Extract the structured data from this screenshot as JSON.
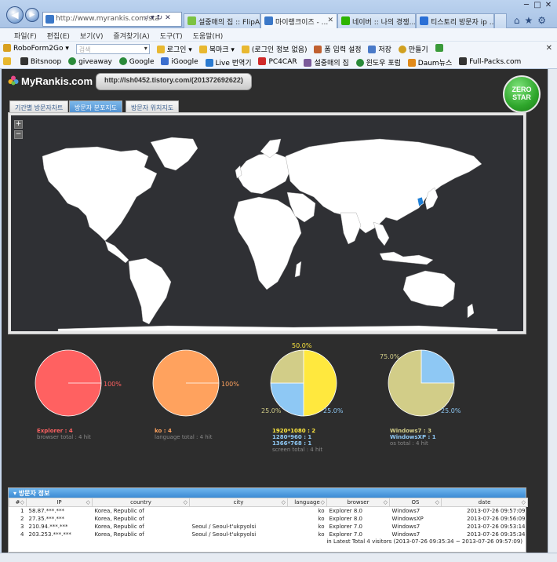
{
  "browser": {
    "address": "http://www.myrankis.com/sta",
    "address_host": "myrankis.com",
    "tabs": [
      {
        "label": "설중매의 집 :: FlipAl...",
        "color": "#7cc242"
      },
      {
        "label": "마이랭크이즈 - ...",
        "color": "#3b78c8"
      },
      {
        "label": "네이버 :: 나의 경쟁...",
        "color": "#2db400"
      },
      {
        "label": "티스토리 방문자 ip ...",
        "color": "#2a6fd6"
      }
    ],
    "menu": [
      "파일(F)",
      "편집(E)",
      "보기(V)",
      "즐겨찾기(A)",
      "도구(T)",
      "도움말(H)"
    ],
    "toolbar": {
      "roboform": "RoboForm2Go",
      "search_placeholder": "검색",
      "login": "로그인",
      "bookmark": "북마크",
      "login_info": "(로그인 정보 없음)",
      "form_settings": "폼 입력 설정",
      "save": "저장",
      "make": "만들기"
    },
    "favorites": [
      {
        "label": "Bitsnoop",
        "color": "#333333"
      },
      {
        "label": "giveaway",
        "color": "#2a8a3a"
      },
      {
        "label": "Google",
        "color": "#2a8a3a"
      },
      {
        "label": "iGoogle",
        "color": "#3b6fd0"
      },
      {
        "label": "Live 번역기",
        "color": "#2a7ad0"
      },
      {
        "label": "PC4CAR",
        "color": "#d02a2a"
      },
      {
        "label": "설중매의 집",
        "color": "#7a5a9a"
      },
      {
        "label": "윈도우 포럼",
        "color": "#2a8a3a"
      },
      {
        "label": "Daum뉴스",
        "color": "#e08a1a"
      },
      {
        "label": "Full-Packs.com",
        "color": "#333333"
      }
    ]
  },
  "site": {
    "logo": "MyRankis.com",
    "blog_url": "http://lsh0452.tistory.com/(201372692622)",
    "badge_line1": "ZERO",
    "badge_line2": "STAR",
    "tabs": [
      "기간별 방문자차트",
      "방문자 분포지도",
      "방문자 위치지도"
    ],
    "active_tab": 1,
    "zoom_in": "+",
    "zoom_out": "−"
  },
  "charts": [
    {
      "slices": [
        {
          "value": 100,
          "color": "#ff6161"
        }
      ],
      "pct_labels": [
        {
          "text": "100%",
          "color": "#ff6161"
        }
      ],
      "legend_main": [
        {
          "text": "Explorer : 4",
          "color": "#ff6161"
        }
      ],
      "legend_sub": "browser total : 4 hit"
    },
    {
      "slices": [
        {
          "value": 100,
          "color": "#ffa25e"
        }
      ],
      "pct_labels": [
        {
          "text": "100%",
          "color": "#ffa25e"
        }
      ],
      "legend_main": [
        {
          "text": "ko : 4",
          "color": "#ffa25e"
        }
      ],
      "legend_sub": "language total : 4 hit"
    },
    {
      "slices": [
        {
          "value": 50,
          "color": "#ffe83e"
        },
        {
          "value": 25,
          "color": "#8ec8f4"
        },
        {
          "value": 25,
          "color": "#d2cd88"
        }
      ],
      "pct_labels": [
        {
          "text": "50.0%",
          "color": "#ffe83e"
        },
        {
          "text": "25.0%",
          "color": "#8ec8f4"
        },
        {
          "text": "25.0%",
          "color": "#d2cd88"
        }
      ],
      "legend_main": [
        {
          "text": "1920*1080 : 2",
          "color": "#ffe83e"
        },
        {
          "text": "1280*960 : 1",
          "color": "#8ec8f4"
        },
        {
          "text": "1366*768 : 1",
          "color": "#8ec8f4"
        }
      ],
      "legend_sub": "screen total : 4 hit"
    },
    {
      "slices": [
        {
          "value": 25,
          "color": "#8ec8f4"
        },
        {
          "value": 75,
          "color": "#d2cd88"
        }
      ],
      "pct_labels": [
        {
          "text": "75.0%",
          "color": "#d2cd88"
        },
        {
          "text": "25.0%",
          "color": "#8ec8f4"
        }
      ],
      "legend_main": [
        {
          "text": "Windows7 : 3",
          "color": "#d2cd88"
        },
        {
          "text": "WindowsXP : 1",
          "color": "#8ec8f4"
        }
      ],
      "legend_sub": "os total : 4 hit"
    }
  ],
  "visitors": {
    "title": "방문자 정보",
    "columns": [
      "#",
      "IP",
      "country",
      "city",
      "language",
      "browser",
      "OS",
      "date"
    ],
    "rows": [
      {
        "num": "1",
        "ip": "58.87.***.***",
        "country": "Korea, Republic of",
        "city": "",
        "language": "ko",
        "browser": "Explorer 8.0",
        "os": "Windows7",
        "date": "2013-07-26 09:57:09"
      },
      {
        "num": "2",
        "ip": "27.35.***.***",
        "country": "Korea, Republic of",
        "city": "",
        "language": "ko",
        "browser": "Explorer 8.0",
        "os": "WindowsXP",
        "date": "2013-07-26 09:56:09"
      },
      {
        "num": "3",
        "ip": "210.94.***.***",
        "country": "Korea, Republic of",
        "city": "Seoul / Seoul-t'ukpyolsi",
        "language": "ko",
        "browser": "Explorer 7.0",
        "os": "Windows7",
        "date": "2013-07-26 09:53:14"
      },
      {
        "num": "4",
        "ip": "203.253.***.***",
        "country": "Korea, Republic of",
        "city": "Seoul / Seoul-t'ukpyolsi",
        "language": "ko",
        "browser": "Explorer 7.0",
        "os": "Windows7",
        "date": "2013-07-26 09:35:34"
      }
    ],
    "summary": "in Latest Total 4 visitors (2013-07-26 09:35:34 ~ 2013-07-26 09:57:09)"
  },
  "map_marker_color": "#1f7fd6"
}
